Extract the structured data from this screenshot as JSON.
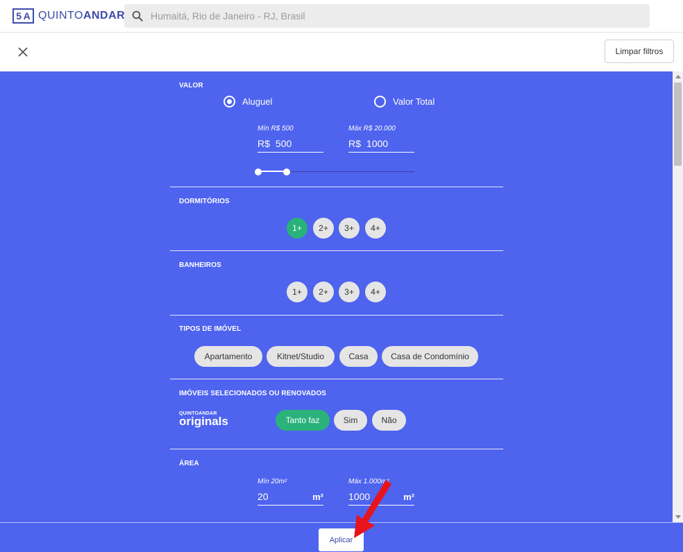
{
  "header": {
    "logo_mark_left": "5",
    "logo_mark_right": "A",
    "logo_text_light": "QUINTO",
    "logo_text_bold": "ANDAR",
    "search_placeholder": "Humaitá, Rio de Janeiro - RJ, Brasil",
    "search_icon": "search-icon"
  },
  "subheader": {
    "close_icon": "close-icon",
    "clear_label": "Limpar filtros"
  },
  "valor": {
    "title": "VALOR",
    "options": [
      {
        "label": "Aluguel",
        "selected": true
      },
      {
        "label": "Valor Total",
        "selected": false
      }
    ],
    "min_label": "Mín R$ 500",
    "max_label": "Máx R$ 20.000",
    "min_prefix": "R$",
    "min_value": "500",
    "max_prefix": "R$",
    "max_value": "1000"
  },
  "dormitorios": {
    "title": "DORMITÓRIOS",
    "options": [
      {
        "label": "1+",
        "selected": true
      },
      {
        "label": "2+",
        "selected": false
      },
      {
        "label": "3+",
        "selected": false
      },
      {
        "label": "4+",
        "selected": false
      }
    ]
  },
  "banheiros": {
    "title": "BANHEIROS",
    "options": [
      {
        "label": "1+",
        "selected": false
      },
      {
        "label": "2+",
        "selected": false
      },
      {
        "label": "3+",
        "selected": false
      },
      {
        "label": "4+",
        "selected": false
      }
    ]
  },
  "tipos": {
    "title": "TIPOS DE IMÓVEL",
    "options": [
      {
        "label": "Apartamento",
        "selected": false
      },
      {
        "label": "Kitnet/Studio",
        "selected": false
      },
      {
        "label": "Casa",
        "selected": false
      },
      {
        "label": "Casa de Condomínio",
        "selected": false
      }
    ]
  },
  "selecionados": {
    "title": "IMÓVEIS SELECIONADOS OU RENOVADOS",
    "brand_small": "QUINTOANDAR",
    "brand_big": "originals",
    "options": [
      {
        "label": "Tanto faz",
        "selected": true
      },
      {
        "label": "Sim",
        "selected": false
      },
      {
        "label": "Não",
        "selected": false
      }
    ]
  },
  "area": {
    "title": "ÁREA",
    "min_label": "Mín 20m²",
    "max_label": "Máx 1.000m²",
    "min_value": "20",
    "min_unit": "m²",
    "max_value": "1000",
    "max_unit": "m²"
  },
  "footer": {
    "apply_label": "Aplicar"
  },
  "colors": {
    "panel": "#4e63ee",
    "selected_chip": "#2ab27b",
    "brand": "#3b4aa8",
    "annotation_arrow": "#e8141b"
  }
}
